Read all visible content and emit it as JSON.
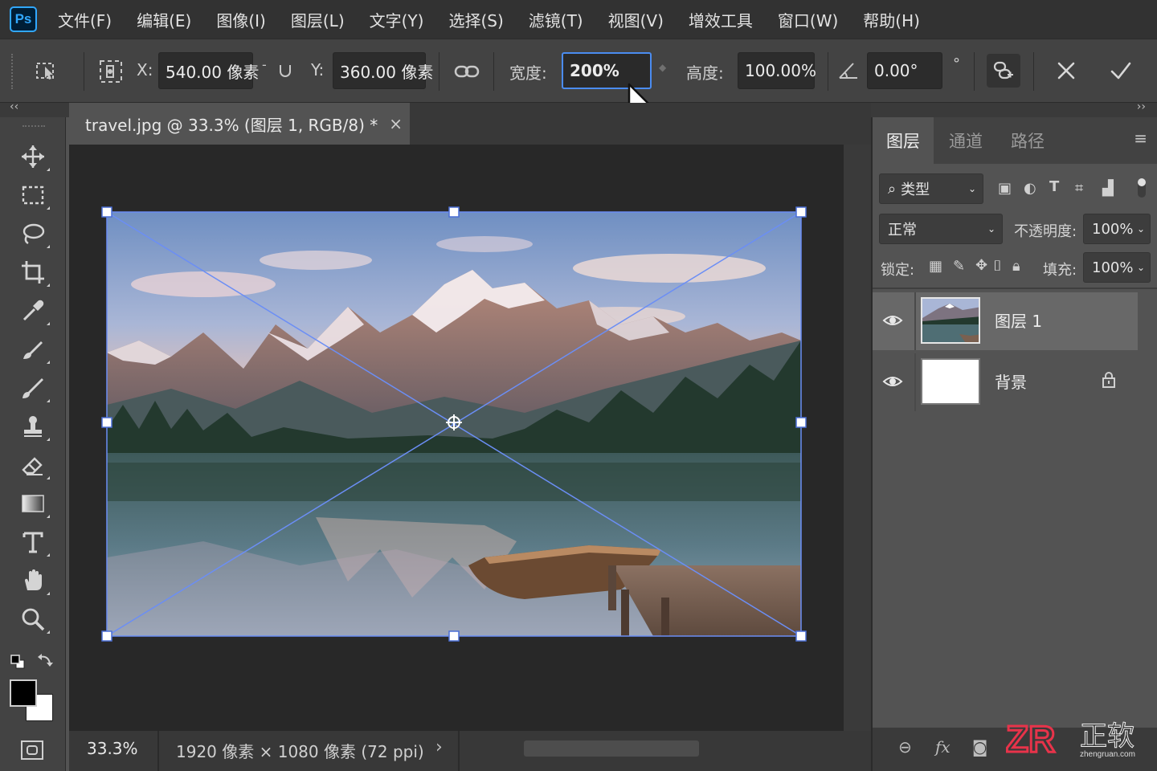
{
  "app": {
    "logo": "Ps"
  },
  "menu": [
    "文件(F)",
    "编辑(E)",
    "图像(I)",
    "图层(L)",
    "文字(Y)",
    "选择(S)",
    "滤镜(T)",
    "视图(V)",
    "增效工具",
    "窗口(W)",
    "帮助(H)"
  ],
  "options": {
    "x_label": "X:",
    "x_value": "540.00 像素",
    "y_label": "Y:",
    "y_value": "360.00 像素",
    "width_label": "宽度:",
    "width_value": "200%",
    "height_label": "高度:",
    "height_value": "100.00%",
    "angle_value": "0.00°",
    "degree_symbol": "°"
  },
  "panel_toggles": {
    "left": "‹‹",
    "right": "››"
  },
  "document": {
    "tab_title": "travel.jpg @ 33.3% (图层 1, RGB/8) *",
    "close_glyph": "×"
  },
  "status": {
    "zoom": "33.3%",
    "doc_info": "1920 像素 × 1080 像素 (72 ppi)",
    "arrow": "›"
  },
  "layers_panel": {
    "tabs": [
      "图层",
      "通道",
      "路径"
    ],
    "active_tab": "图层",
    "filter_label": "类型",
    "blend_mode": "正常",
    "opacity_label": "不透明度:",
    "opacity_value": "100%",
    "lock_label": "锁定:",
    "fill_label": "填充:",
    "fill_value": "100%",
    "layers": [
      {
        "name": "图层 1",
        "visible": true,
        "selected": true,
        "locked": false
      },
      {
        "name": "背景",
        "visible": true,
        "selected": false,
        "locked": true
      }
    ],
    "bottom_fx": "fx"
  },
  "icons": {
    "tools": [
      "move-icon",
      "marquee-icon",
      "lasso-icon",
      "crop-icon",
      "eyedropper-icon",
      "healing-brush-icon",
      "brush-icon",
      "stamp-icon",
      "eraser-icon",
      "gradient-icon",
      "type-icon",
      "hand-icon",
      "zoom-icon"
    ]
  },
  "colors": {
    "foreground": "#000000",
    "background": "#ffffff",
    "accent": "#4b8cf0",
    "transform_lines": "#6b8ef5"
  },
  "watermark": {
    "brand": "ZR",
    "chinese": "正软",
    "domain": "zhengruan.com"
  }
}
